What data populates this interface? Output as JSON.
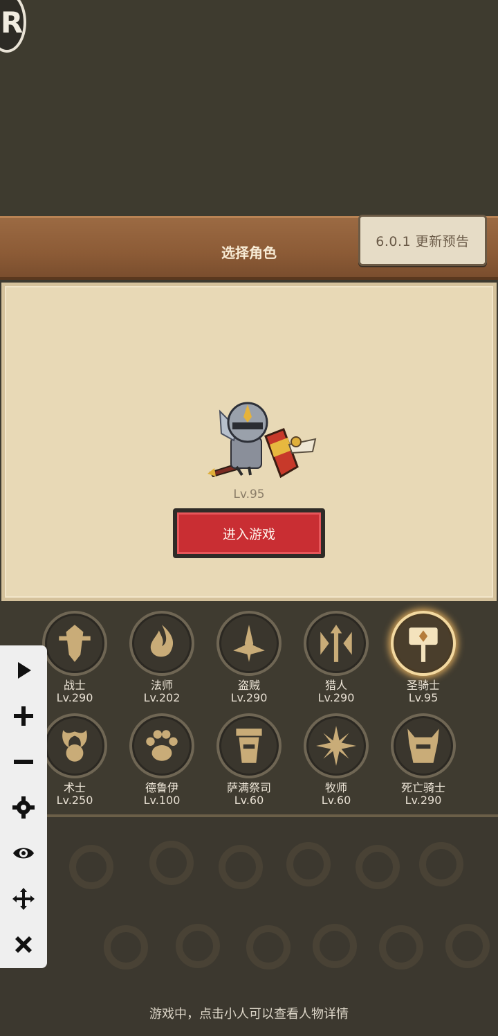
{
  "header": {
    "title": "选择角色",
    "update_label": "6.0.1 更新预告"
  },
  "character": {
    "level": "Lv.95",
    "enter_label": "进入游戏"
  },
  "classes": [
    {
      "name": "战士",
      "level": "Lv.290",
      "icon": "sword-shield-icon",
      "selected": false
    },
    {
      "name": "法师",
      "level": "Lv.202",
      "icon": "flame-icon",
      "selected": false
    },
    {
      "name": "盗贼",
      "level": "Lv.290",
      "icon": "daggers-icon",
      "selected": false
    },
    {
      "name": "猎人",
      "level": "Lv.290",
      "icon": "arrows-icon",
      "selected": false
    },
    {
      "name": "圣骑士",
      "level": "Lv.95",
      "icon": "hammer-icon",
      "selected": true
    },
    {
      "name": "术士",
      "level": "Lv.250",
      "icon": "skull-icon",
      "selected": false
    },
    {
      "name": "德鲁伊",
      "level": "Lv.100",
      "icon": "paw-icon",
      "selected": false
    },
    {
      "name": "萨满祭司",
      "level": "Lv.60",
      "icon": "totem-icon",
      "selected": false
    },
    {
      "name": "牧师",
      "level": "Lv.60",
      "icon": "star-icon",
      "selected": false
    },
    {
      "name": "死亡骑士",
      "level": "Lv.290",
      "icon": "helm-icon",
      "selected": false
    }
  ],
  "footer": {
    "tip": "游戏中，点击小人可以查看人物详情"
  },
  "overlay": {
    "logo_letter": "R"
  }
}
